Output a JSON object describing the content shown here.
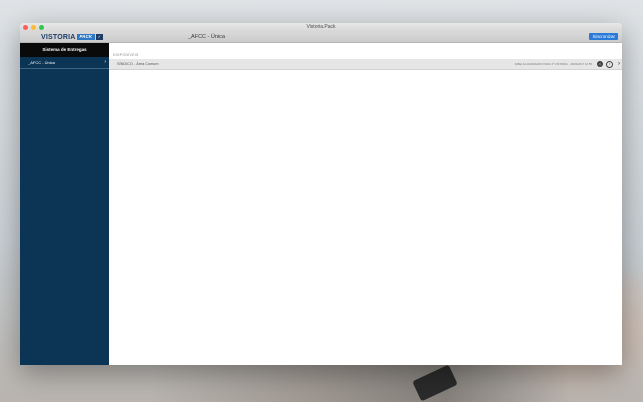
{
  "window": {
    "title": "Vistoria.Pack"
  },
  "toolbar": {
    "logo_word": "VISTORIA",
    "logo_tag": "PACK",
    "project_title": "_AFCC - Única",
    "sync_label": "Sincronizar"
  },
  "sidebar": {
    "header": "Sistema de Entregas",
    "items": [
      {
        "label": "_AFCC - Única"
      }
    ]
  },
  "main": {
    "section_label": "DISPONÍVEIS",
    "rows": [
      {
        "label": "SÍNDICO - Área Comum",
        "meta": "[CBE] AGUARDANDO PARA 1ª VISTORIA · 29/03/2017 10:55"
      }
    ]
  },
  "colors": {
    "sidebar_bg": "#0c3555",
    "sidebar_header_bg": "#0a0a0a",
    "accent": "#2a7ad8"
  }
}
